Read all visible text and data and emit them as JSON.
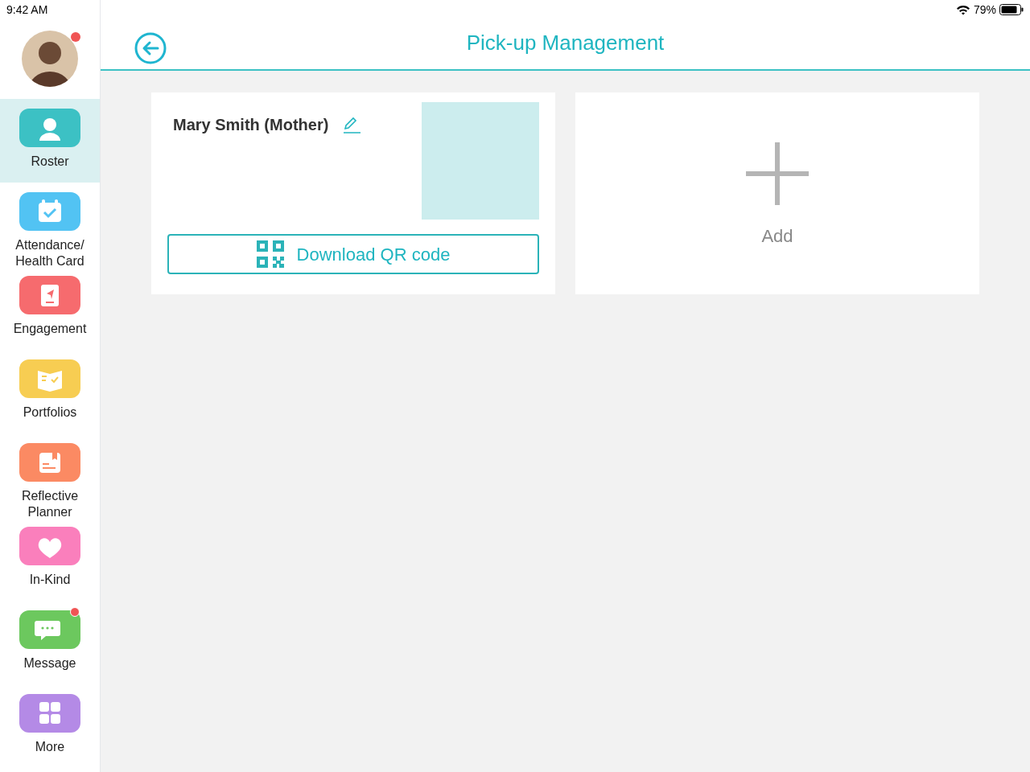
{
  "status_bar": {
    "time": "9:42 AM",
    "battery": "79%"
  },
  "sidebar": {
    "avatar": {
      "badge": true
    },
    "items": [
      {
        "label": "Roster",
        "kind": "person",
        "color": "#3cc1c4",
        "selected": true,
        "badge": false
      },
      {
        "label": "Attendance/\nHealth Card",
        "kind": "calendar",
        "color": "#52c3f3",
        "selected": false,
        "badge": false
      },
      {
        "label": "Engagement",
        "kind": "send",
        "color": "#f66b6e",
        "selected": false,
        "badge": false
      },
      {
        "label": "Portfolios",
        "kind": "book",
        "color": "#f7cd52",
        "selected": false,
        "badge": false
      },
      {
        "label": "Reflective\nPlanner",
        "kind": "planner",
        "color": "#fb8a63",
        "selected": false,
        "badge": false
      },
      {
        "label": "In-Kind",
        "kind": "heart",
        "color": "#fa7fbc",
        "selected": false,
        "badge": false
      },
      {
        "label": "Message",
        "kind": "chat",
        "color": "#6cc85e",
        "selected": false,
        "badge": true
      },
      {
        "label": "More",
        "kind": "grid",
        "color": "#b48ae6",
        "selected": false,
        "badge": false
      }
    ]
  },
  "header": {
    "title": "Pick-up Management"
  },
  "cards": [
    {
      "kind": "contact",
      "name": "Mary Smith (Mother)",
      "button": "Download QR code"
    },
    {
      "kind": "add",
      "label": "Add"
    }
  ]
}
